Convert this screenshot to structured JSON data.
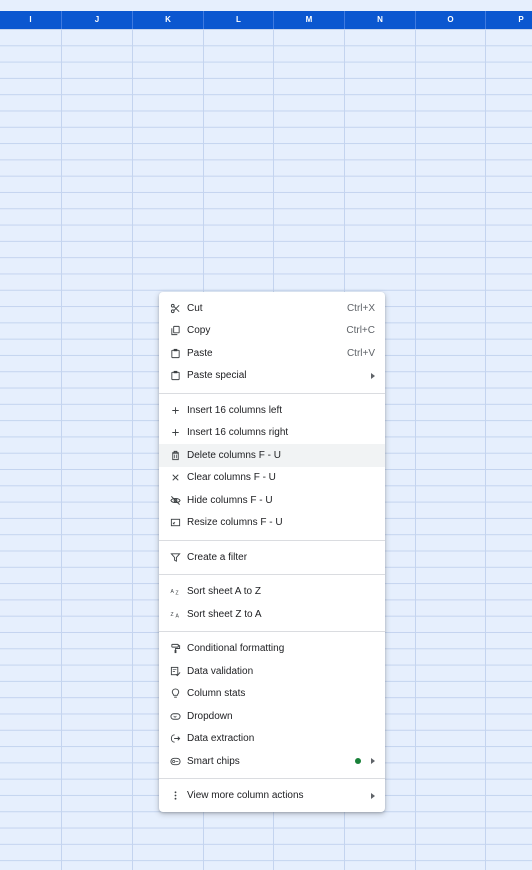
{
  "columns": [
    "I",
    "J",
    "K",
    "L",
    "M",
    "N",
    "O",
    "P"
  ],
  "accent_color": "#0b57d0",
  "new_dot_color": "#188038",
  "menu": {
    "cut": {
      "label": "Cut",
      "shortcut": "Ctrl+X",
      "icon": "scissors-icon"
    },
    "copy": {
      "label": "Copy",
      "shortcut": "Ctrl+C",
      "icon": "copy-icon"
    },
    "paste": {
      "label": "Paste",
      "shortcut": "Ctrl+V",
      "icon": "clipboard-icon"
    },
    "paste_special": {
      "label": "Paste special",
      "icon": "clipboard-icon"
    },
    "insert_left": {
      "label": "Insert 16 columns left",
      "icon": "plus-icon"
    },
    "insert_right": {
      "label": "Insert 16 columns right",
      "icon": "plus-icon"
    },
    "delete_columns": {
      "label": "Delete columns F - U",
      "icon": "trash-icon"
    },
    "clear_columns": {
      "label": "Clear columns F - U",
      "icon": "close-icon"
    },
    "hide_columns": {
      "label": "Hide columns F - U",
      "icon": "eye-off-icon"
    },
    "resize_columns": {
      "label": "Resize columns F - U",
      "icon": "resize-icon"
    },
    "create_filter": {
      "label": "Create a filter",
      "icon": "filter-icon"
    },
    "sort_az": {
      "label": "Sort sheet A to Z",
      "icon": "sort-az-icon"
    },
    "sort_za": {
      "label": "Sort sheet Z to A",
      "icon": "sort-za-icon"
    },
    "conditional_formatting": {
      "label": "Conditional formatting",
      "icon": "paint-roller-icon"
    },
    "data_validation": {
      "label": "Data validation",
      "icon": "validation-icon"
    },
    "column_stats": {
      "label": "Column stats",
      "icon": "lightbulb-icon"
    },
    "dropdown": {
      "label": "Dropdown",
      "icon": "dropdown-chip-icon"
    },
    "data_extraction": {
      "label": "Data extraction",
      "icon": "extraction-icon"
    },
    "smart_chips": {
      "label": "Smart chips",
      "icon": "smart-chip-icon"
    },
    "view_more": {
      "label": "View more column actions",
      "icon": "more-vert-icon"
    }
  }
}
